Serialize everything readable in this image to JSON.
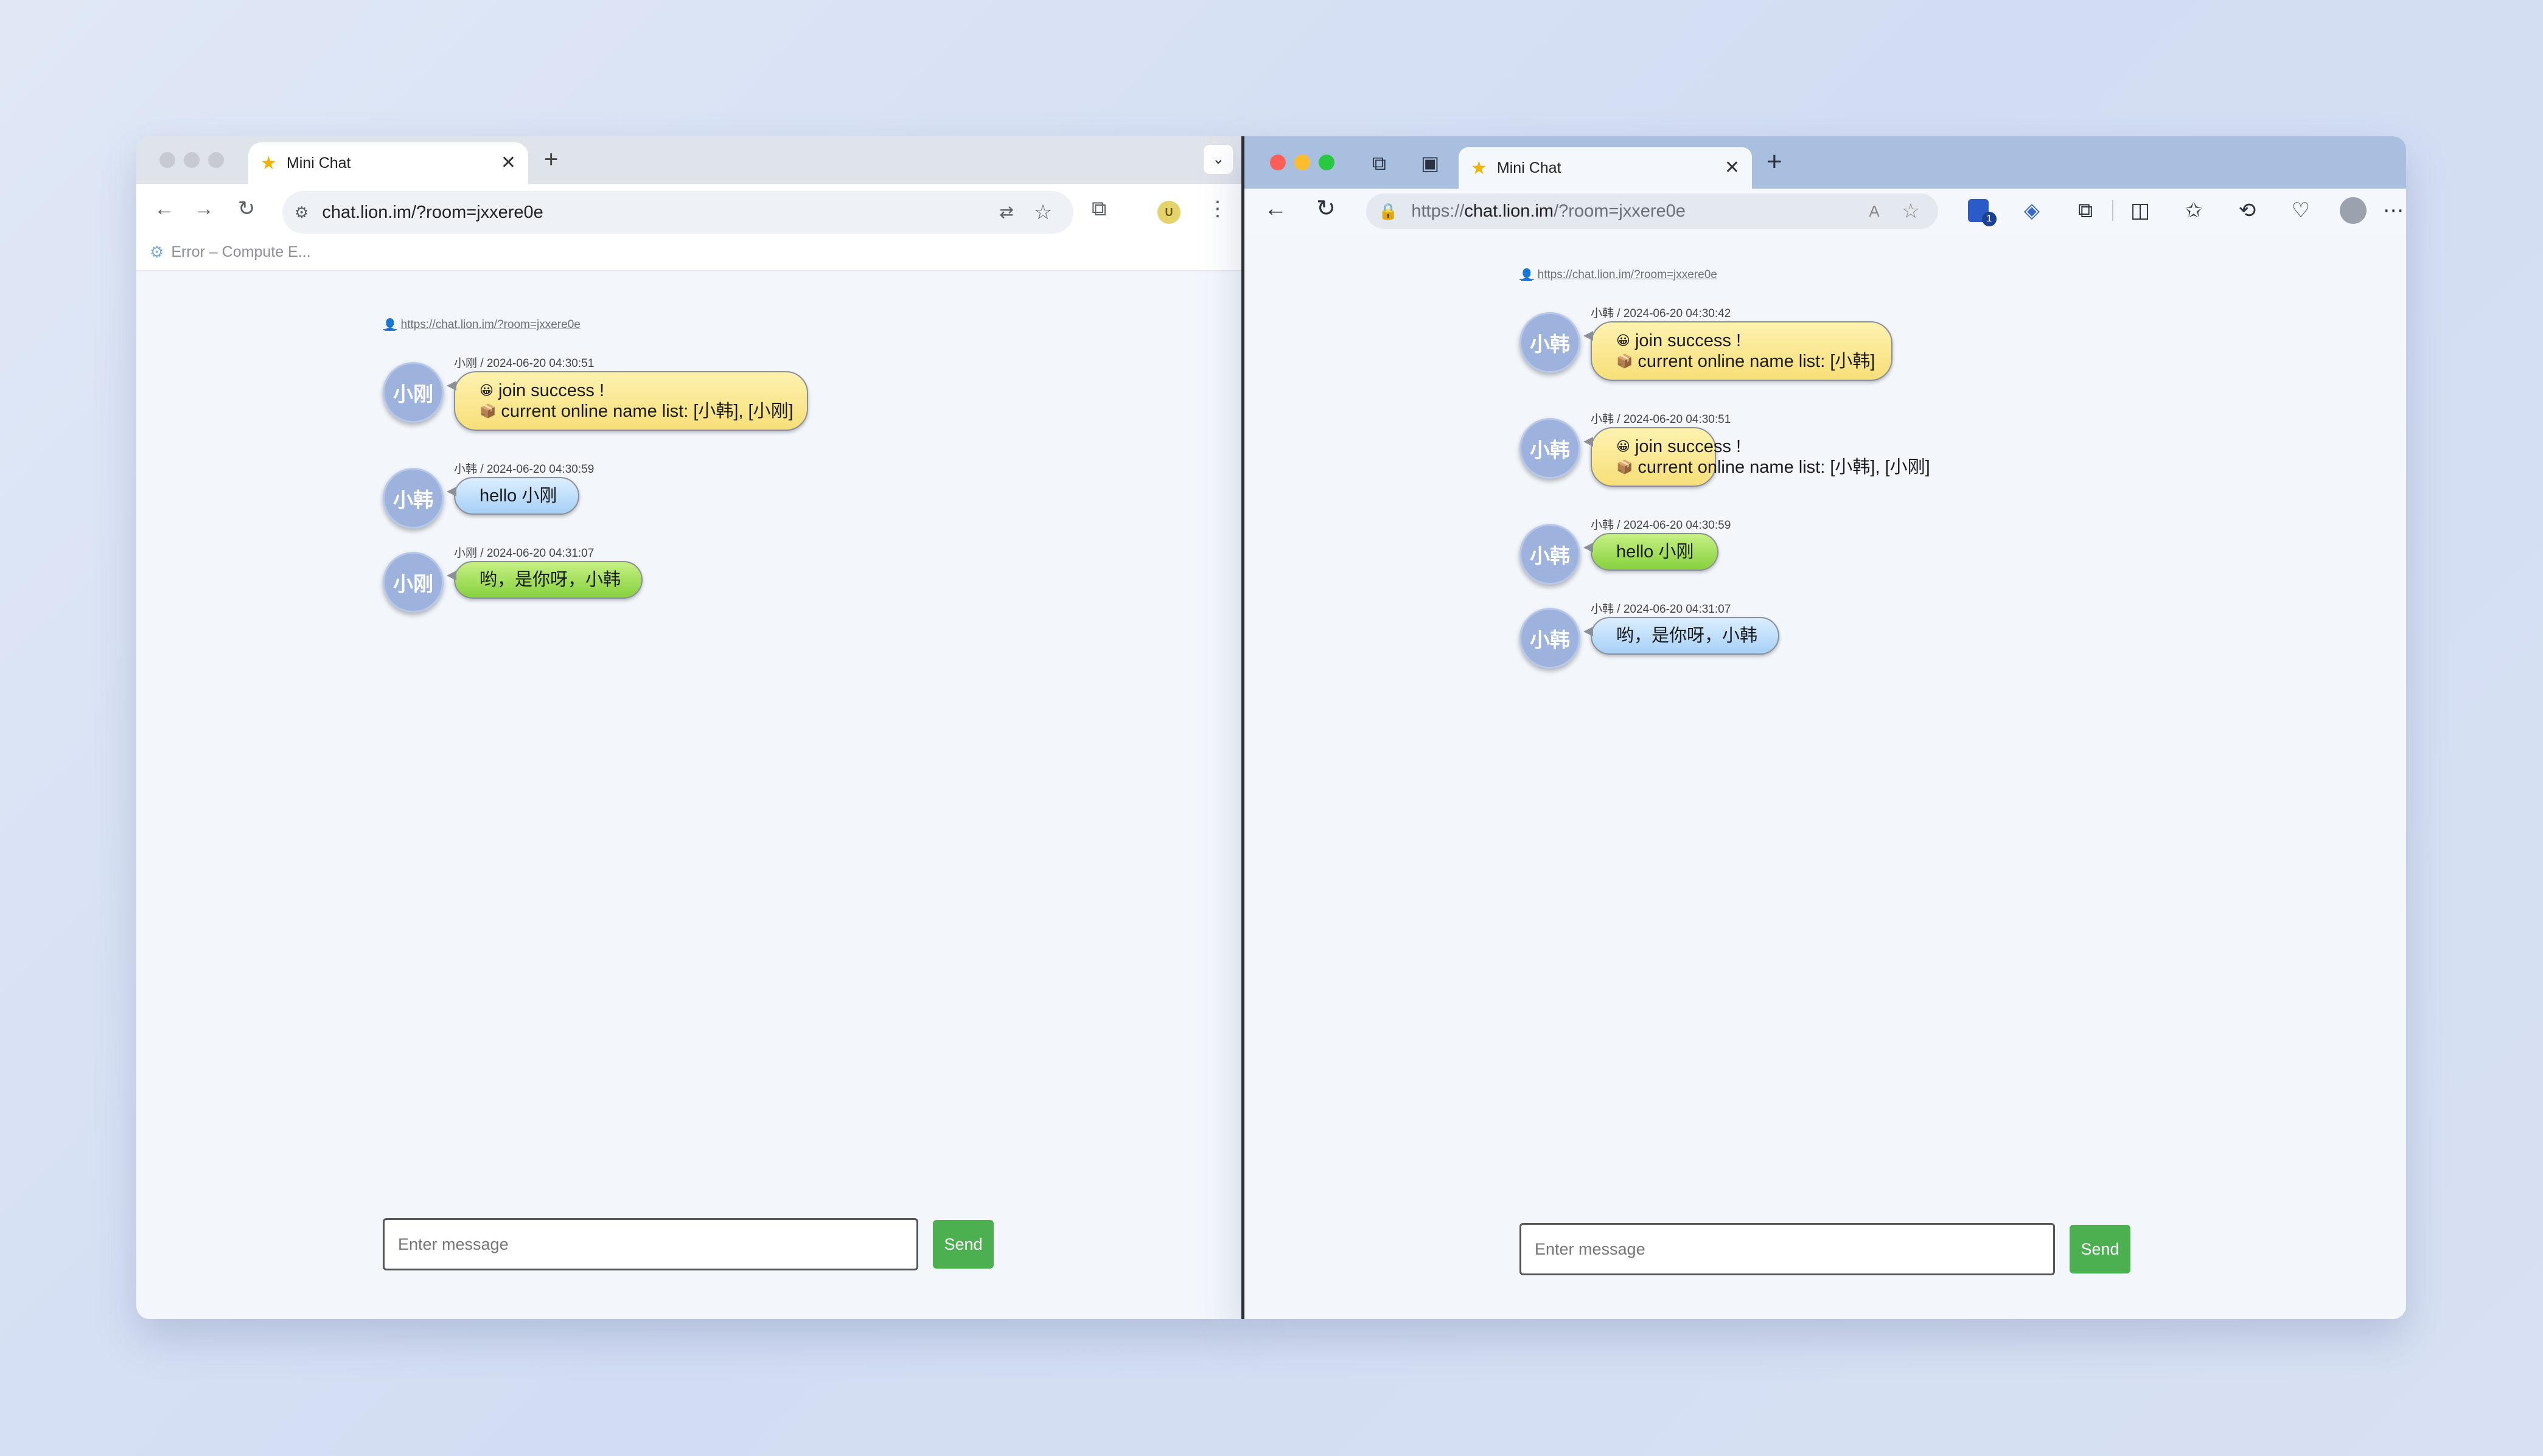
{
  "tab_title": "Mini Chat",
  "left": {
    "address": "chat.lion.im/?room=jxxere0e",
    "bookmark": "Error – Compute E...",
    "room_link": "https://chat.lion.im/?room=jxxere0e",
    "messages": [
      {
        "avatar": "小刚",
        "meta": "小刚 / 2024-06-20 04:30:51",
        "style": "yellow",
        "lines": [
          [
            "😀",
            "join success !"
          ],
          [
            "📦",
            "current online name list: [小韩], [小刚]"
          ]
        ]
      },
      {
        "avatar": "小韩",
        "meta": "小韩 / 2024-06-20 04:30:59",
        "style": "blue",
        "lines": [
          [
            "",
            "hello 小刚"
          ]
        ]
      },
      {
        "avatar": "小刚",
        "meta": "小刚 / 2024-06-20 04:31:07",
        "style": "green",
        "lines": [
          [
            "",
            "哟，是你呀，小韩"
          ]
        ]
      }
    ],
    "input_placeholder": "Enter message",
    "send_label": "Send"
  },
  "right": {
    "address_prefix": "https://",
    "address_host": "chat.lion.im",
    "address_path": "/?room=jxxere0e",
    "badge_count": "1",
    "room_link": "https://chat.lion.im/?room=jxxere0e",
    "messages": [
      {
        "avatar": "小韩",
        "meta": "小韩 / 2024-06-20 04:30:42",
        "style": "yellow",
        "lines": [
          [
            "😀",
            "join success !"
          ],
          [
            "📦",
            "current online name list: [小韩]"
          ]
        ]
      },
      {
        "avatar": "小韩",
        "meta": "小韩 / 2024-06-20 04:30:51",
        "style": "yellow",
        "lines": [
          [
            "😀",
            "join success !"
          ],
          [
            "📦",
            "current online name list: [小韩], [小刚]"
          ]
        ]
      },
      {
        "avatar": "小韩",
        "meta": "小韩 / 2024-06-20 04:30:59",
        "style": "green",
        "lines": [
          [
            "",
            "hello 小刚"
          ]
        ]
      },
      {
        "avatar": "小韩",
        "meta": "小韩 / 2024-06-20 04:31:07",
        "style": "blue",
        "lines": [
          [
            "",
            "哟，是你呀，小韩"
          ]
        ]
      }
    ],
    "input_placeholder": "Enter message",
    "send_label": "Send"
  }
}
